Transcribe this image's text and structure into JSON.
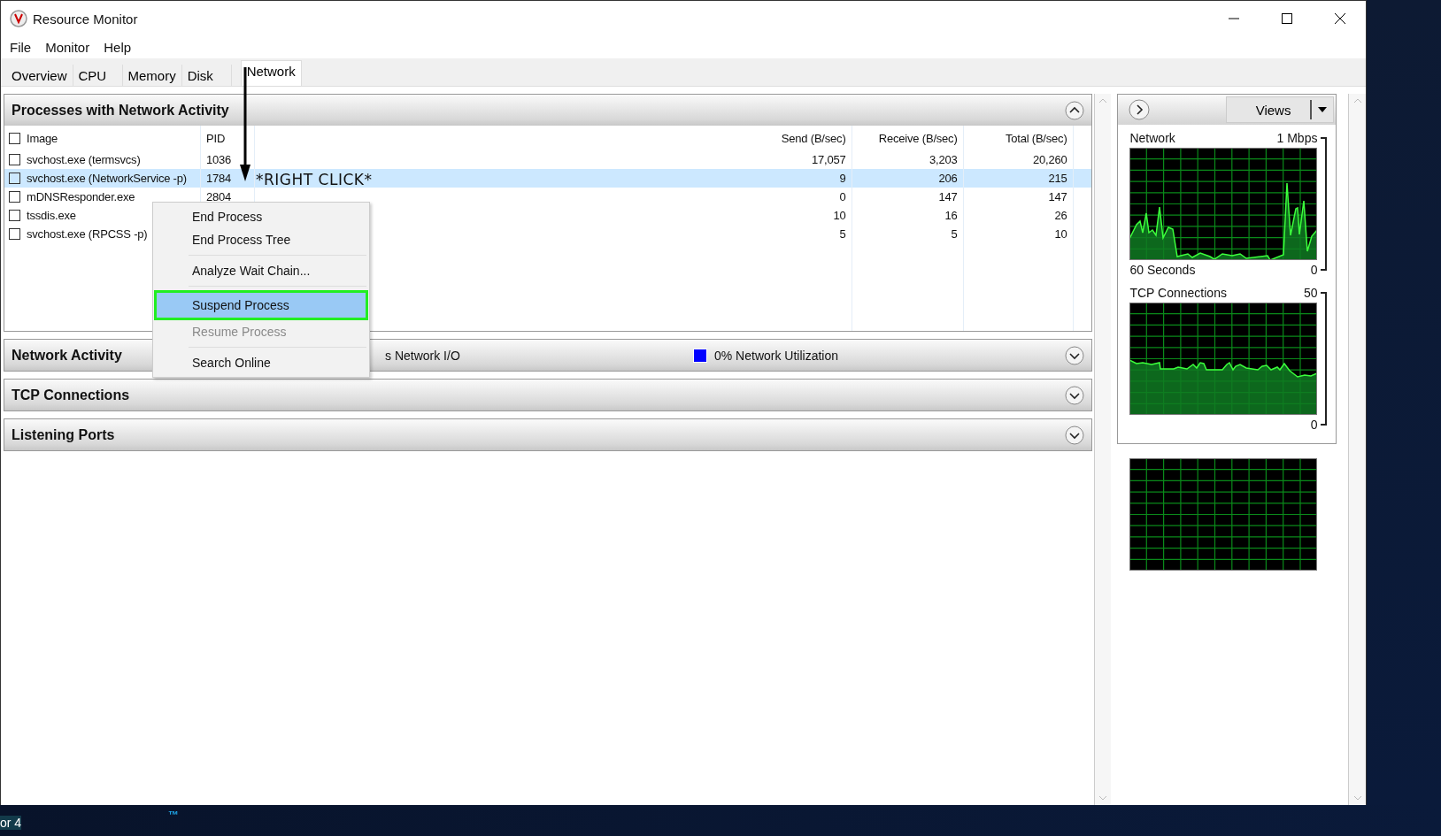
{
  "window": {
    "title": "Resource Monitor"
  },
  "menu": [
    "File",
    "Monitor",
    "Help"
  ],
  "tabs": [
    {
      "label": "Overview",
      "selected": false
    },
    {
      "label": "CPU",
      "selected": false
    },
    {
      "label": "Memory",
      "selected": false
    },
    {
      "label": "Disk",
      "selected": false
    },
    {
      "label": "Network",
      "selected": true
    }
  ],
  "processes": {
    "title": "Processes with Network Activity",
    "expanded": true,
    "header_checked": false,
    "columns": [
      "Image",
      "PID",
      "Send (B/sec)",
      "Receive (B/sec)",
      "Total (B/sec)"
    ],
    "rows": [
      {
        "checked": false,
        "selected": false,
        "image": "svchost.exe (termsvcs)",
        "pid": "1036",
        "send": "17,057",
        "receive": "3,203",
        "total": "20,260"
      },
      {
        "checked": false,
        "selected": true,
        "image": "svchost.exe (NetworkService -p)",
        "pid": "1784",
        "send": "9",
        "receive": "206",
        "total": "215"
      },
      {
        "checked": false,
        "selected": false,
        "image": "mDNSResponder.exe",
        "pid": "2804",
        "send": "0",
        "receive": "147",
        "total": "147"
      },
      {
        "checked": false,
        "selected": false,
        "image": "tssdis.exe",
        "send": "10",
        "receive": "16",
        "total": "26"
      },
      {
        "checked": false,
        "selected": false,
        "image": "svchost.exe (RPCSS -p)",
        "send": "5",
        "receive": "5",
        "total": "10"
      }
    ]
  },
  "sections": [
    {
      "title": "Network Activity",
      "expanded": false,
      "io": "s Network I/O",
      "utilization": "0% Network Utilization",
      "color": "#0000ff"
    },
    {
      "title": "TCP Connections",
      "expanded": false
    },
    {
      "title": "Listening Ports",
      "expanded": false
    }
  ],
  "context_menu": [
    {
      "kind": "item",
      "label": "End Process",
      "selected": false,
      "outlined": false,
      "disabled": false
    },
    {
      "kind": "item",
      "label": "End Process Tree",
      "selected": false,
      "outlined": false,
      "disabled": false
    },
    {
      "kind": "separator"
    },
    {
      "kind": "item",
      "label": "Analyze Wait Chain...",
      "selected": false,
      "outlined": false,
      "disabled": false
    },
    {
      "kind": "separator"
    },
    {
      "kind": "item",
      "label": "Suspend Process",
      "selected": true,
      "outlined": true,
      "disabled": false
    },
    {
      "kind": "item",
      "label": "Resume Process",
      "selected": false,
      "outlined": false,
      "disabled": true
    },
    {
      "kind": "separator"
    },
    {
      "kind": "item",
      "label": "Search Online",
      "selected": false,
      "outlined": false,
      "disabled": false
    }
  ],
  "annotation": {
    "label": "*RIGHT CLICK*"
  },
  "side_panel": {
    "views_button": "Views",
    "graphs": [
      {
        "kind": "network",
        "title": "Network",
        "max": "1 Mbps",
        "footer": "60 Seconds",
        "min": "0"
      },
      {
        "kind": "tcp",
        "title": "TCP Connections",
        "max": "50",
        "min": "0"
      },
      {
        "kind": "empty"
      }
    ]
  },
  "desktop": {
    "text": "or 4",
    "mark": "™"
  }
}
